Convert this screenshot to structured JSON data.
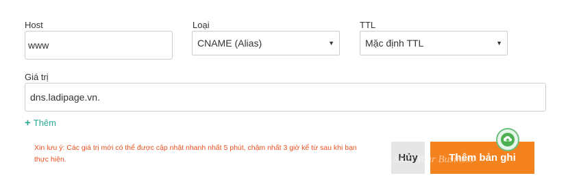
{
  "host": {
    "label": "Host",
    "value": "www"
  },
  "type": {
    "label": "Loại",
    "selected": "CNAME (Alias)"
  },
  "ttl": {
    "label": "TTL",
    "selected": "Mặc định TTL"
  },
  "value": {
    "label": "Giá trị",
    "value": "dns.ladipage.vn."
  },
  "add_more": {
    "icon": "plus-icon",
    "label": "Thêm"
  },
  "note": "Xin lưu ý: Các giá trị mới có thể được cập nhật nhanh nhất 5 phút, chậm nhất 3 giờ kể từ sau khi bạn thực hiện.",
  "buttons": {
    "cancel": "Hủy",
    "add_record": "Thêm bản ghi"
  },
  "watermark": "Start Your Business",
  "colors": {
    "accent": "#2bab94",
    "warning_text": "#e8501f",
    "primary_button": "#f4831f",
    "secondary_button": "#e6e6e6"
  }
}
